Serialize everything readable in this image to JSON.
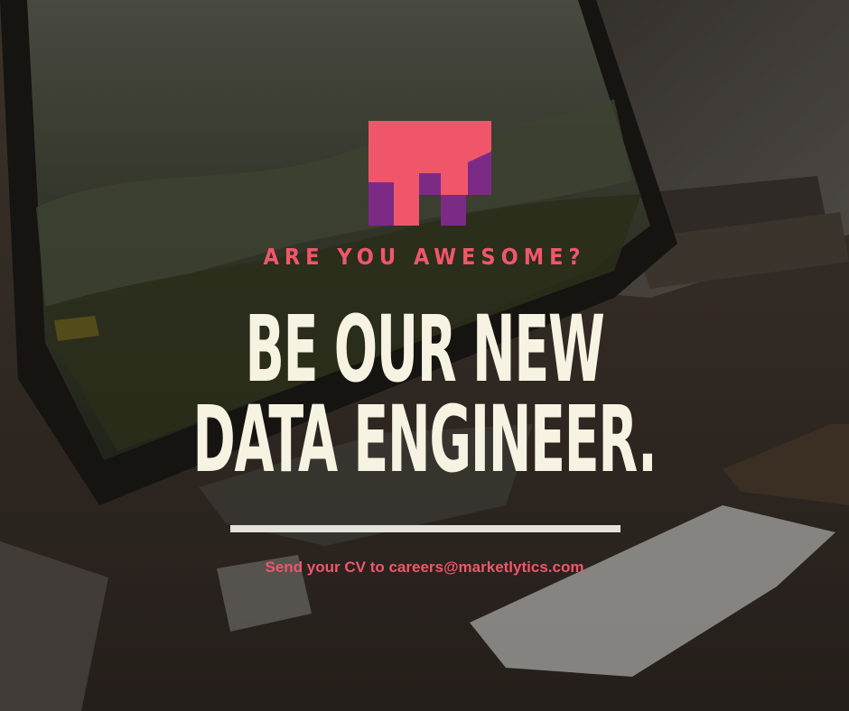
{
  "poster": {
    "tagline": "ARE YOU AWESOME?",
    "headline_line1": "BE OUR NEW",
    "headline_line2": "DATA ENGINEER.",
    "cta": "Send your CV to careers@marketlytics.com"
  },
  "logo": {
    "icon": "marketlytics-m-logo",
    "top_color": "#f0566a",
    "bottom_color": "#7b2b86"
  },
  "colors": {
    "accent": "#f0566a",
    "headline": "#f7f3e3",
    "divider": "#e4e2dc"
  }
}
